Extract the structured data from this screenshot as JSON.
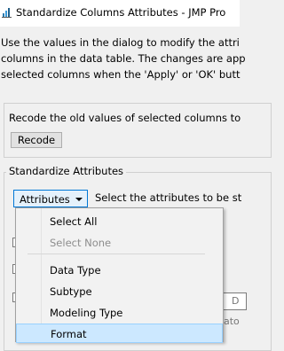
{
  "window": {
    "title": "Standardize Columns Attributes - JMP Pro"
  },
  "description": {
    "lines": [
      "Use the values in the dialog to modify the attri",
      "columns in the data table. The changes are app",
      "selected columns when the 'Apply' or 'OK' butt"
    ]
  },
  "recode_group": {
    "text": "Recode the old values of selected columns to",
    "button_label": "Recode"
  },
  "standardize_group": {
    "legend": "Standardize Attributes",
    "attributes_button_label": "Attributes",
    "hint": "Select the attributes to be st"
  },
  "background": {
    "field_fragment": "D",
    "text_fragment": "ato"
  },
  "menu": {
    "items": [
      {
        "label": "Select All",
        "enabled": true
      },
      {
        "label": "Select None",
        "enabled": false
      },
      {
        "label": "Data Type",
        "enabled": true
      },
      {
        "label": "Subtype",
        "enabled": true
      },
      {
        "label": "Modeling Type",
        "enabled": true
      },
      {
        "label": "Format",
        "enabled": true,
        "highlighted": true
      }
    ]
  },
  "colors": {
    "menu_highlight": "#cce8ff",
    "button_focus_border": "#0078d7",
    "disabled_text": "#8d8d8d"
  }
}
